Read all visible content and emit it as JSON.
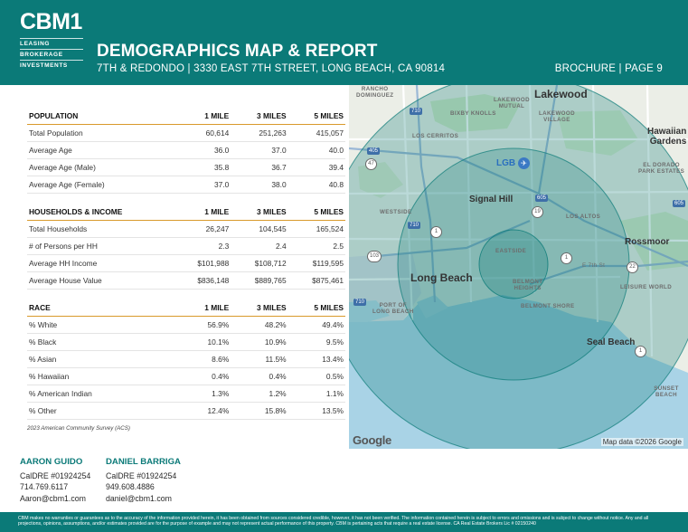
{
  "brand": {
    "logo": "CBM1",
    "lines": [
      "LEASING",
      "BROKERAGE",
      "INVESTMENTS"
    ],
    "accent_color": "#0b7a78",
    "rule_color": "#d99a2b"
  },
  "header": {
    "title": "DEMOGRAPHICS MAP & REPORT",
    "subtitle": "7TH & REDONDO | 3330 EAST 7TH STREET, LONG BEACH, CA 90814",
    "page_label": "BROCHURE | PAGE 9"
  },
  "tables": {
    "population": {
      "headers": [
        "POPULATION",
        "1 MILE",
        "3 MILES",
        "5 MILES"
      ],
      "rows": [
        [
          "Total Population",
          "60,614",
          "251,263",
          "415,057"
        ],
        [
          "Average Age",
          "36.0",
          "37.0",
          "40.0"
        ],
        [
          "Average Age (Male)",
          "35.8",
          "36.7",
          "39.4"
        ],
        [
          "Average Age (Female)",
          "37.0",
          "38.0",
          "40.8"
        ]
      ]
    },
    "households": {
      "headers": [
        "HOUSEHOLDS & INCOME",
        "1 MILE",
        "3 MILES",
        "5 MILES"
      ],
      "rows": [
        [
          "Total Households",
          "26,247",
          "104,545",
          "165,524"
        ],
        [
          "# of Persons per HH",
          "2.3",
          "2.4",
          "2.5"
        ],
        [
          "Average HH Income",
          "$101,988",
          "$108,712",
          "$119,595"
        ],
        [
          "Average House Value",
          "$836,148",
          "$889,765",
          "$875,461"
        ]
      ]
    },
    "race": {
      "headers": [
        "RACE",
        "1 MILE",
        "3 MILES",
        "5 MILES"
      ],
      "rows": [
        [
          "% White",
          "56.9%",
          "48.2%",
          "49.4%"
        ],
        [
          "% Black",
          "10.1%",
          "10.9%",
          "9.5%"
        ],
        [
          "% Asian",
          "8.6%",
          "11.5%",
          "13.4%"
        ],
        [
          "% Hawaiian",
          "0.4%",
          "0.4%",
          "0.5%"
        ],
        [
          "% American Indian",
          "1.3%",
          "1.2%",
          "1.1%"
        ],
        [
          "% Other",
          "12.4%",
          "15.8%",
          "13.5%"
        ]
      ]
    },
    "source": "2023 American Community Survey (ACS)"
  },
  "map": {
    "labels": {
      "rancho": "RANCHO\nDOMINGUEZ",
      "lakewood_mutual": "LAKEWOOD\nMUTUAL",
      "lakewood": "Lakewood",
      "bixby": "BIXBY KNOLLS",
      "lakewood_village": "LAKEWOOD\nVILLAGE",
      "los_cerritos": "LOS CERRITOS",
      "hawaiian": "Hawaiian\nGardens",
      "lgb": "LGB",
      "el_dorado": "EL DORADO\nPARK ESTATES",
      "signal_hill": "Signal Hill",
      "westside": "WESTSIDE",
      "los_altos": "LOS ALTOS",
      "rossmoor": "Rossmoor",
      "eastside": "EASTSIDE",
      "long_beach": "Long Beach",
      "e7th": "E 7th St",
      "belmont_heights": "BELMONT\nHEIGHTS",
      "leisure": "LEISURE WORLD",
      "port": "PORT OF\nLONG BEACH",
      "belmont_shore": "BELMONT SHORE",
      "seal_beach": "Seal Beach",
      "sunset": "SUNSET BEACH"
    },
    "shields": {
      "s710": "710",
      "s405": "405",
      "s47": "47",
      "s605": "605",
      "s19": "19",
      "s710b": "710",
      "s1a": "1",
      "s605b": "605",
      "s103": "103",
      "s1b": "1",
      "s22": "22",
      "s710c": "710",
      "s1c": "1"
    },
    "airport_icon": "airplane-icon",
    "google": "Google",
    "attribution": "Map data ©2026 Google"
  },
  "contacts": [
    {
      "name": "AARON GUIDO",
      "license": "CalDRE #01924254",
      "phone": "714.769.6117",
      "email": "Aaron@cbm1.com"
    },
    {
      "name": "DANIEL BARRIGA",
      "license": "CalDRE #01924254",
      "phone": "949.608.4886",
      "email": "daniel@cbm1.com"
    }
  ],
  "footer": {
    "disclaimer": "CBM makes no warranties or guarantees as to the accuracy of the information provided herein, it has been obtained from sources considered credible, however, it has not been verified. The information contained herein is subject to errors and omissions and is subject to change without notice. Any and all projections, opinions, assumptions, and/or estimates provided are for the purpose of example and may not represent actual performance of this property. CBM is pertaining acts that require a real estate license. CA Real Estate Brokers Lic # 02150240"
  }
}
